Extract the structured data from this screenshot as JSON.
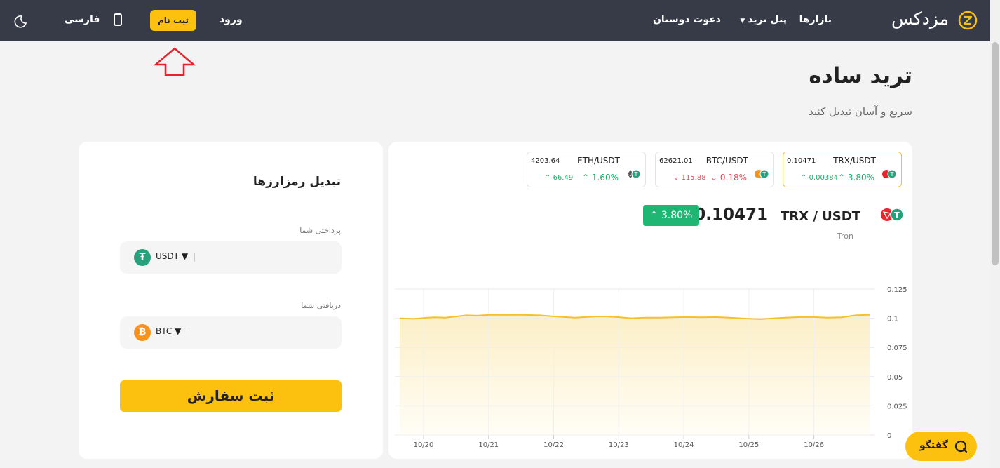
{
  "header": {
    "logo_text": "مزدکس",
    "nav_markets": "بازارها",
    "nav_trade_panel": "پنل ترید",
    "nav_invite": "دعوت دوستان",
    "login": "ورود",
    "signup": "ثبت نام",
    "language": "فارسی"
  },
  "page": {
    "title": "ترید ساده",
    "subtitle": "سریع و آسان تبدیل کنید"
  },
  "converter": {
    "title": "تبدیل رمزارزها",
    "pay_label": "پرداختی شما",
    "pay_coin": "USDT",
    "receive_label": "دریافتی شما",
    "receive_coin": "BTC",
    "submit": "ثبت سفارش"
  },
  "tickers": [
    {
      "pair": "TRX/USDT",
      "price": "0.10471",
      "pct": "3.80%",
      "change": "0.00384",
      "direction": "up",
      "active": true
    },
    {
      "pair": "BTC/USDT",
      "price": "62621.01",
      "pct": "0.18%",
      "change": "115.88",
      "direction": "down",
      "active": false
    },
    {
      "pair": "ETH/USDT",
      "price": "4203.64",
      "pct": "1.60%",
      "change": "66.49",
      "direction": "up",
      "active": false
    }
  ],
  "selected": {
    "pair": "TRX / USDT",
    "name": "Tron",
    "price": "0.10471",
    "pct": "3.80%"
  },
  "chat": {
    "label": "گفتگو"
  },
  "colors": {
    "header_bg": "#363b47",
    "accent": "#fcc00f",
    "up": "#1fae6a",
    "down": "#e94959",
    "line": "#f6c02c"
  },
  "chart_data": {
    "type": "area",
    "x_tick_labels": [
      "10/20",
      "10/21",
      "10/22",
      "10/23",
      "10/24",
      "10/25",
      "10/26"
    ],
    "y_tick_labels": [
      "0",
      "0.025",
      "0.05",
      "0.075",
      "0.1",
      "0.125"
    ],
    "ylim": [
      0,
      0.125
    ],
    "x_range": [
      0,
      6.5
    ],
    "x": [
      -0.3,
      -0.1,
      0.1,
      0.2,
      0.35,
      0.5,
      0.65,
      0.8,
      1.0,
      1.2,
      1.4,
      1.5,
      1.7,
      1.85,
      2.0,
      2.2,
      2.35,
      2.5,
      2.65,
      2.8,
      3.0,
      3.2,
      3.4,
      3.6,
      3.8,
      4.0,
      4.2,
      4.4,
      4.55,
      4.7,
      4.85,
      5.0,
      5.2,
      5.4,
      5.6,
      5.8,
      6.0,
      6.2,
      6.4
    ],
    "y": [
      0.1,
      0.0995,
      0.1005,
      0.1008,
      0.1005,
      0.1015,
      0.1025,
      0.1022,
      0.103,
      0.1028,
      0.103,
      0.1028,
      0.1025,
      0.1018,
      0.1012,
      0.1005,
      0.101,
      0.1015,
      0.1015,
      0.101,
      0.1,
      0.1005,
      0.1005,
      0.1008,
      0.101,
      0.1008,
      0.101,
      0.1005,
      0.1,
      0.0995,
      0.0992,
      0.0998,
      0.1005,
      0.101,
      0.101,
      0.1005,
      0.1008,
      0.1025,
      0.103
    ]
  }
}
